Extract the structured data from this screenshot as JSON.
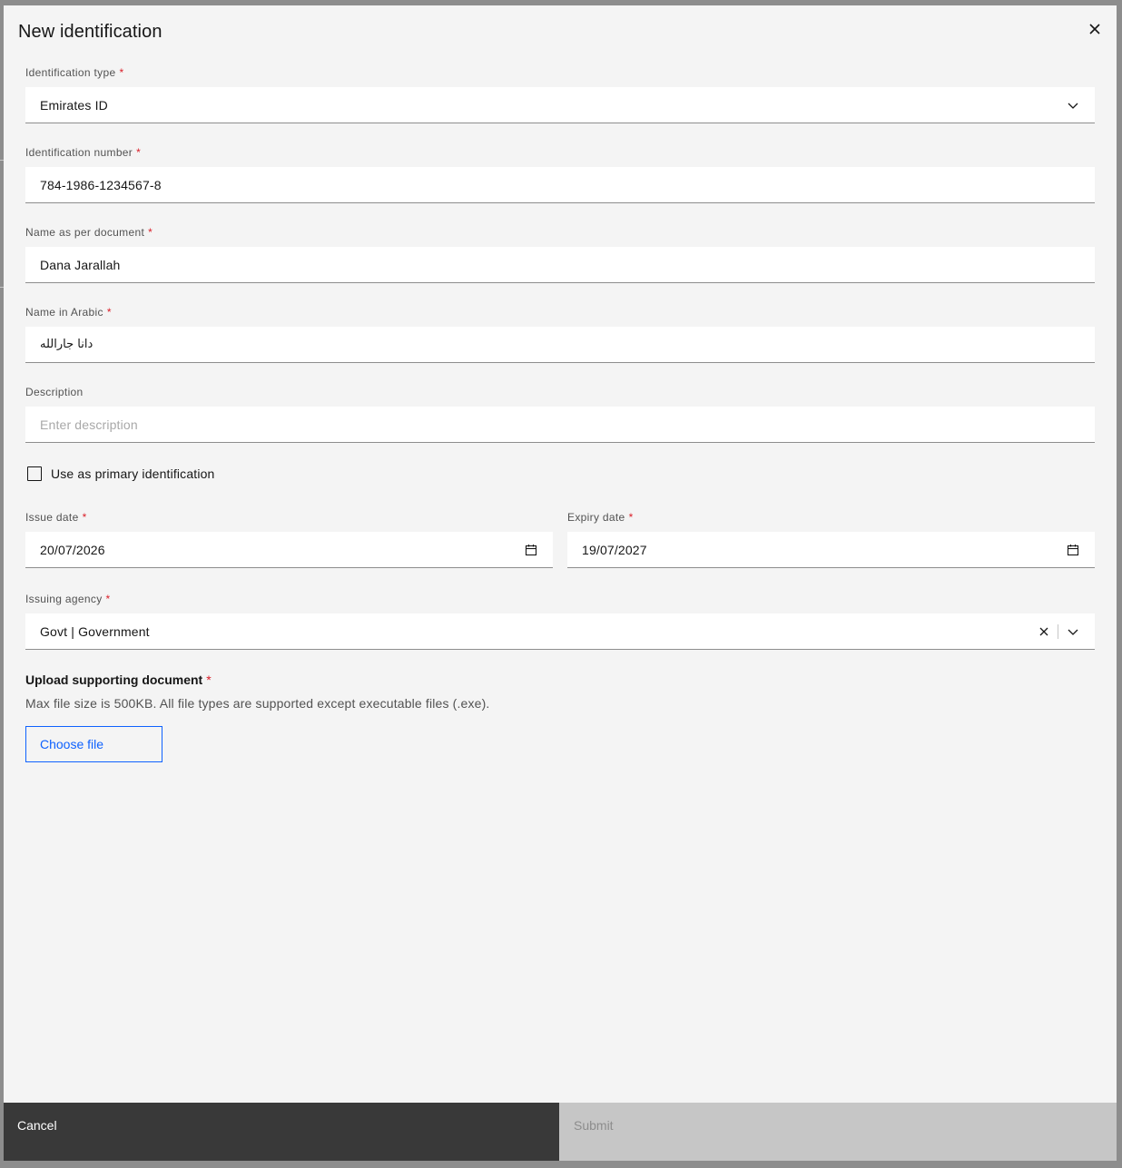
{
  "modal": {
    "title": "New identification",
    "close_icon": "close-icon"
  },
  "fields": {
    "identification_type": {
      "label": "Identification type",
      "required": "*",
      "value": "Emirates ID",
      "icon": "chevron-down-icon"
    },
    "identification_number": {
      "label": "Identification number",
      "required": "*",
      "value": "784-1986-1234567-8"
    },
    "name_as_per_document": {
      "label": "Name as per document",
      "required": "*",
      "value": "Dana Jarallah"
    },
    "name_in_arabic": {
      "label": "Name in Arabic",
      "required": "*",
      "value": "دانا جارالله"
    },
    "description": {
      "label": "Description",
      "placeholder": "Enter description",
      "value": ""
    },
    "primary_identification": {
      "label": "Use as primary identification",
      "checked": false
    },
    "issue_date": {
      "label": "Issue date",
      "required": "*",
      "value": "20/07/2026",
      "icon": "calendar-icon"
    },
    "expiry_date": {
      "label": "Expiry date",
      "required": "*",
      "value": "19/07/2027",
      "icon": "calendar-icon"
    },
    "issuing_agency": {
      "label": "Issuing agency",
      "required": "*",
      "value": "Govt | Government",
      "clear_icon": "clear-icon",
      "icon": "chevron-down-icon"
    }
  },
  "upload": {
    "title": "Upload supporting document",
    "required": "*",
    "help": "Max file size is 500KB. All file types are supported except executable files (.exe).",
    "button_label": "Choose file"
  },
  "footer": {
    "cancel_label": "Cancel",
    "submit_label": "Submit"
  },
  "colors": {
    "required": "#da1e28",
    "primary": "#0f62fe",
    "cancel_bg": "#393939",
    "submit_disabled_bg": "#c6c6c6"
  }
}
